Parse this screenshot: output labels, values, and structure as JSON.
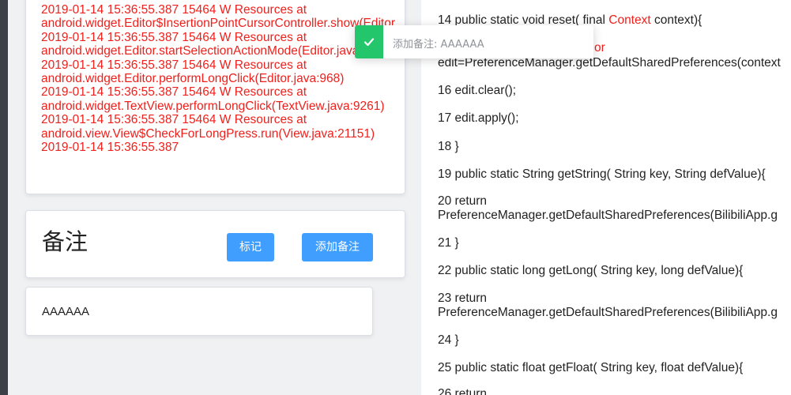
{
  "log": {
    "lines": [
      "2019-01-14 15:36:55.387 15464 W Resources at",
      "android.widget.Editor$InsertionPointCursorController.show(Editor",
      "2019-01-14 15:36:55.387 15464 W Resources at",
      "android.widget.Editor.startSelectionActionMode(Editor.java",
      "2019-01-14 15:36:55.387 15464 W Resources at",
      "android.widget.Editor.performLongClick(Editor.java:968)",
      "2019-01-14 15:36:55.387 15464 W Resources at",
      "android.widget.TextView.performLongClick(TextView.java:9261)",
      "2019-01-14 15:36:55.387 15464 W Resources at",
      "android.view.View$CheckForLongPress.run(View.java:21151)",
      "2019-01-14 15:36:55.387"
    ]
  },
  "notes": {
    "title": "备注",
    "mark_button": "标记",
    "add_button": "添加备注",
    "items": [
      "AAAAAA"
    ]
  },
  "toast": {
    "message": "添加备注: AAAAAA",
    "color": "#23c66b"
  },
  "code": {
    "line14_a": "14 public static void reset( final ",
    "line14_kw": "Context",
    "line14_b": " context){",
    "line15_kw": "or",
    "line15": "edit=PreferenceManager.getDefaultSharedPreferences(context",
    "line16": "16 edit.clear();",
    "line17": "17 edit.apply();",
    "line18": "18 }",
    "line19": "19 public static String getString( String key, String defValue){",
    "line20a": "20 return",
    "line20b": "PreferenceManager.getDefaultSharedPreferences(BilibiliApp.g",
    "line21": "21 }",
    "line22": "22 public static long getLong( String key, long defValue){",
    "line23a": "23 return",
    "line23b": "PreferenceManager.getDefaultSharedPreferences(BilibiliApp.g",
    "line24": "24 }",
    "line25": "25 public static float getFloat( String key, float defValue){",
    "line26a": "26 return"
  },
  "colors": {
    "accent": "#409eff",
    "error_text": "#f0201c",
    "success": "#23c66b"
  }
}
